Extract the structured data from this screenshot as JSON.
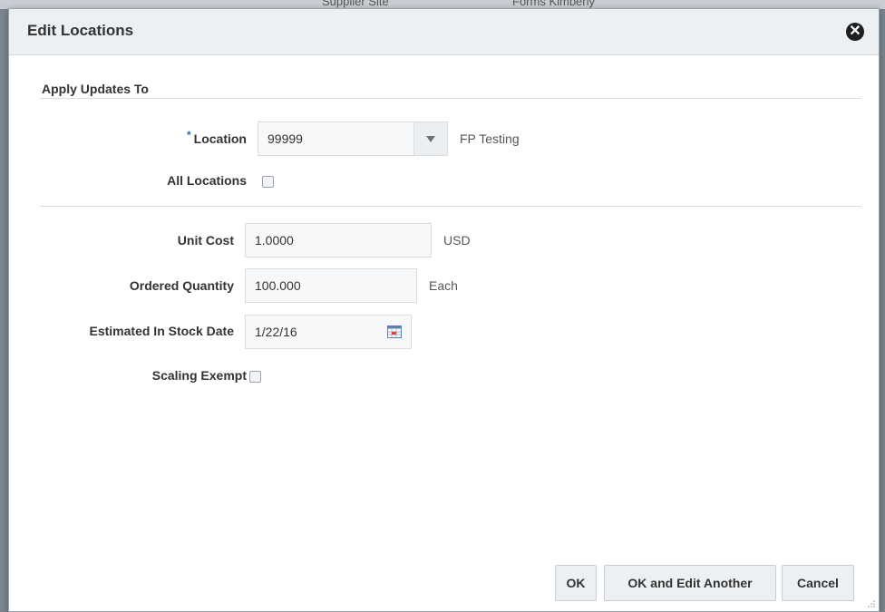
{
  "backdrop": {
    "left_text": "Supplier Site",
    "right_text": "Forms Kimberly"
  },
  "dialog": {
    "title": "Edit Locations",
    "close_icon": "close-icon",
    "section_title": "Apply Updates To",
    "location": {
      "required_marker": "*",
      "label": "Location",
      "value": "99999",
      "description": "FP Testing"
    },
    "all_locations": {
      "label": "All Locations",
      "checked": false
    },
    "unit_cost": {
      "label": "Unit Cost",
      "value": "1.0000",
      "unit": "USD"
    },
    "ordered_quantity": {
      "label": "Ordered Quantity",
      "value": "100.000",
      "unit": "Each"
    },
    "estimated_in_stock_date": {
      "label": "Estimated In Stock Date",
      "value": "1/22/16",
      "icon": "calendar-icon"
    },
    "scaling_exempt": {
      "label": "Scaling Exempt",
      "checked": false
    },
    "buttons": {
      "ok": "OK",
      "ok_edit_another": "OK and Edit Another",
      "cancel": "Cancel"
    }
  },
  "colors": {
    "header_bg": "#edf0f3",
    "required_marker": "#1f6fb5",
    "backdrop": "#7d8690"
  }
}
